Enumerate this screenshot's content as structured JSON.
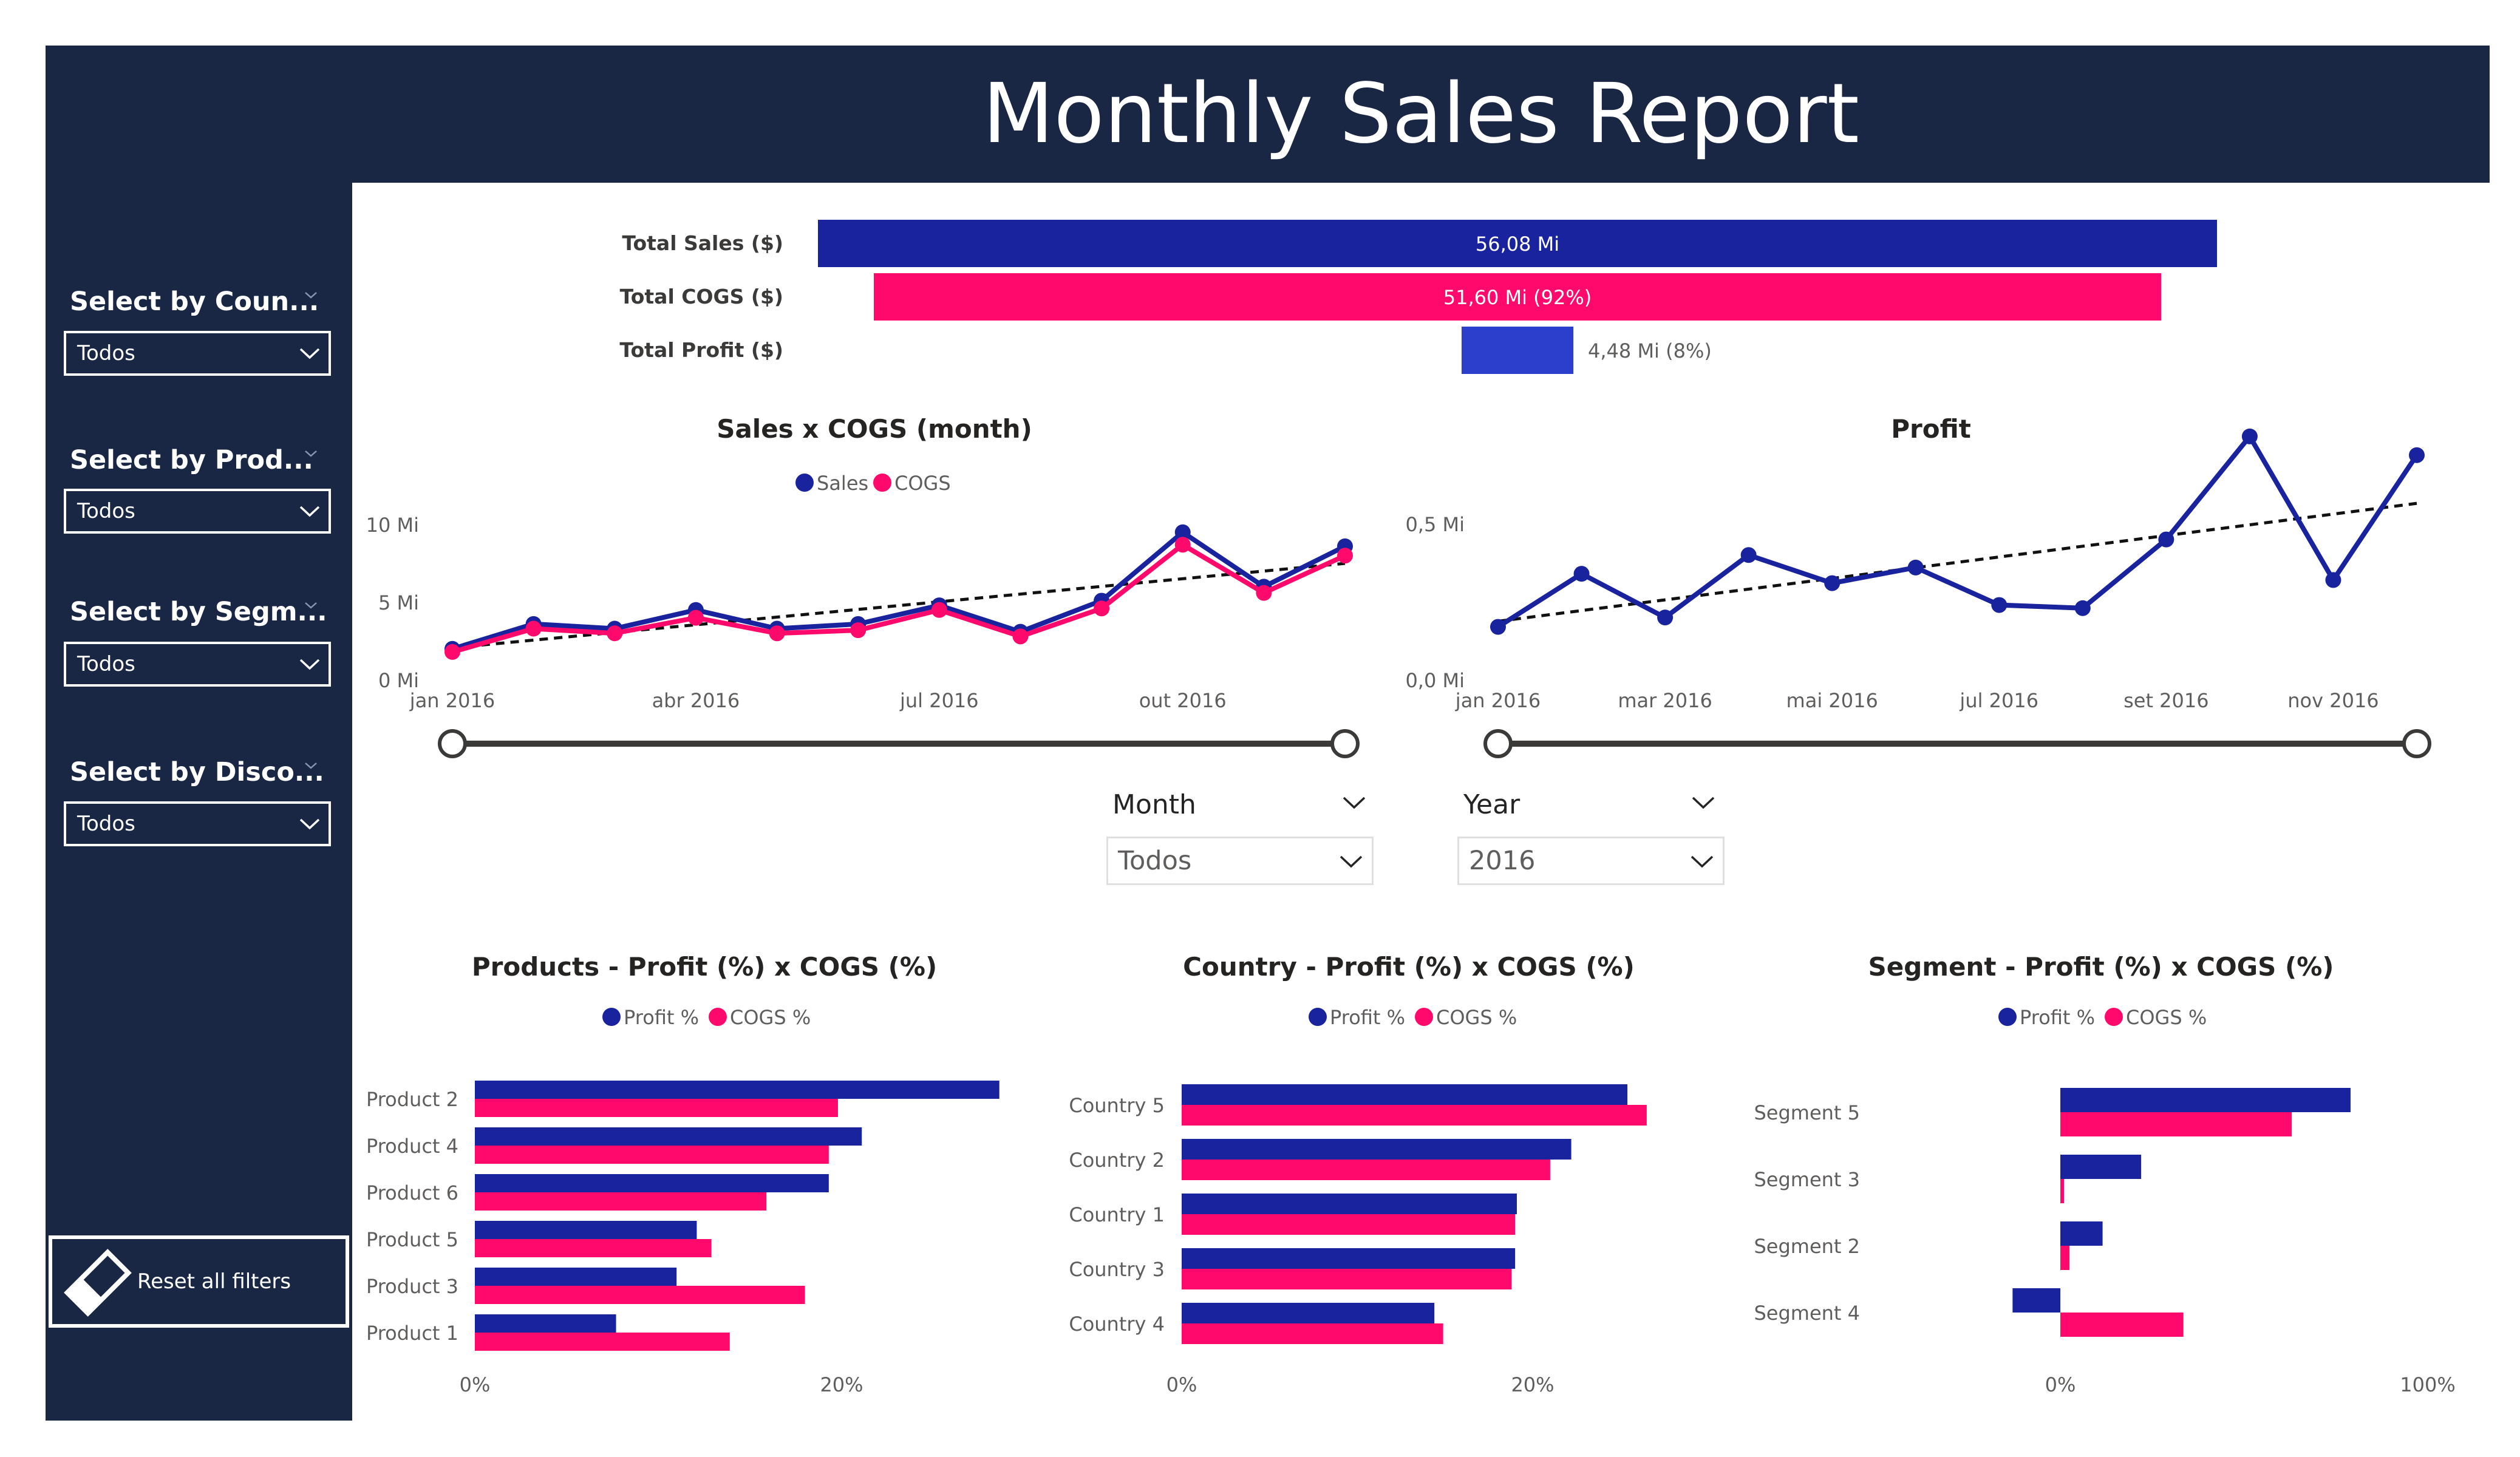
{
  "header": {
    "title": "Monthly Sales Report"
  },
  "colors": {
    "navy": "#1a2744",
    "sales": "#1a239e",
    "cogs": "#ff0a6c",
    "profit": "#2c3fcc"
  },
  "sidebar": {
    "slicers": [
      {
        "title": "Select by Coun...",
        "value": "Todos"
      },
      {
        "title": "Select by Prod...",
        "value": "Todos"
      },
      {
        "title": "Select by Segm...",
        "value": "Todos"
      },
      {
        "title": "Select by Disco...",
        "value": "Todos"
      }
    ],
    "reset_label": "Reset all filters"
  },
  "filters": {
    "month": {
      "label": "Month",
      "value": "Todos"
    },
    "year": {
      "label": "Year",
      "value": "2016"
    }
  },
  "chart_data": [
    {
      "type": "bar",
      "orientation": "horizontal",
      "categories": [
        "Total Sales ($)",
        "Total COGS ($)",
        "Total Profit ($)"
      ],
      "values": [
        56.08,
        51.6,
        4.48
      ],
      "unit": "Mi",
      "data_labels": [
        "56,08 Mi",
        "51,60 Mi (92%)",
        "4,48 Mi (8%)"
      ],
      "colors": [
        "#1a239e",
        "#ff0a6c",
        "#2c3fcc"
      ]
    },
    {
      "type": "line",
      "title": "Sales x COGS (month)",
      "x": [
        "jan 2016",
        "fev 2016",
        "mar 2016",
        "abr 2016",
        "mai 2016",
        "jun 2016",
        "jul 2016",
        "ago 2016",
        "set 2016",
        "out 2016",
        "nov 2016",
        "dez 2016"
      ],
      "x_ticks": [
        "jan 2016",
        "abr 2016",
        "jul 2016",
        "out 2016"
      ],
      "y_ticks": [
        "10 Mi",
        "5 Mi",
        "0 Mi"
      ],
      "ylim": [
        0,
        10
      ],
      "unit": "Mi",
      "legend": "top-center",
      "series": [
        {
          "name": "Sales",
          "values": [
            2.0,
            3.6,
            3.3,
            4.5,
            3.3,
            3.6,
            4.8,
            3.1,
            5.1,
            9.5,
            6.0,
            8.6
          ]
        },
        {
          "name": "COGS",
          "values": [
            1.8,
            3.3,
            3.0,
            4.0,
            3.0,
            3.2,
            4.5,
            2.8,
            4.6,
            8.7,
            5.6,
            8.0
          ]
        }
      ],
      "trendline": true
    },
    {
      "type": "line",
      "title": "Profit",
      "x": [
        "jan 2016",
        "fev 2016",
        "mar 2016",
        "abr 2016",
        "mai 2016",
        "jun 2016",
        "jul 2016",
        "ago 2016",
        "set 2016",
        "out 2016",
        "nov 2016",
        "dez 2016"
      ],
      "x_ticks": [
        "jan 2016",
        "mar 2016",
        "mai 2016",
        "jul 2016",
        "set 2016",
        "nov 2016"
      ],
      "y_ticks": [
        "0,5 Mi",
        "0,0 Mi"
      ],
      "ylim": [
        0,
        0.7
      ],
      "unit": "Mi",
      "series": [
        {
          "name": "Profit",
          "values": [
            0.17,
            0.34,
            0.2,
            0.4,
            0.31,
            0.36,
            0.24,
            0.23,
            0.45,
            0.78,
            0.32,
            0.72
          ]
        }
      ],
      "trendline": true
    },
    {
      "type": "bar",
      "orientation": "horizontal",
      "title": "Products - Profit (%) x COGS (%)",
      "legend": "top-center",
      "categories": [
        "Product 2",
        "Product 4",
        "Product 6",
        "Product 5",
        "Product 3",
        "Product 1"
      ],
      "series": [
        {
          "name": "Profit %",
          "values": [
            28.6,
            21.1,
            19.3,
            12.1,
            11.0,
            7.7
          ]
        },
        {
          "name": "COGS %",
          "values": [
            19.8,
            19.3,
            15.9,
            12.9,
            18.0,
            13.9
          ]
        }
      ],
      "x_ticks": [
        "0%",
        "20%"
      ],
      "xlim": [
        0,
        30
      ]
    },
    {
      "type": "bar",
      "orientation": "horizontal",
      "title": "Country - Profit (%) x COGS (%)",
      "legend": "top-center",
      "categories": [
        "Country 5",
        "Country 2",
        "Country 1",
        "Country 3",
        "Country 4"
      ],
      "series": [
        {
          "name": "Profit %",
          "values": [
            25.4,
            22.2,
            19.1,
            19.0,
            14.4
          ]
        },
        {
          "name": "COGS %",
          "values": [
            26.5,
            21.0,
            19.0,
            18.8,
            14.9
          ]
        }
      ],
      "x_ticks": [
        "0%",
        "20%"
      ],
      "xlim": [
        0,
        30
      ]
    },
    {
      "type": "bar",
      "orientation": "horizontal",
      "title": "Segment - Profit (%) x COGS (%)",
      "legend": "top-center",
      "categories": [
        "Segment 5",
        "Segment 3",
        "Segment 2",
        "Segment 4"
      ],
      "series": [
        {
          "name": "Profit %",
          "values": [
            79.0,
            22.0,
            11.5,
            -13.0
          ]
        },
        {
          "name": "COGS %",
          "values": [
            63.0,
            1.0,
            2.5,
            33.5
          ]
        }
      ],
      "x_ticks": [
        "0%",
        "100%"
      ],
      "xlim": [
        -15,
        100
      ]
    }
  ]
}
